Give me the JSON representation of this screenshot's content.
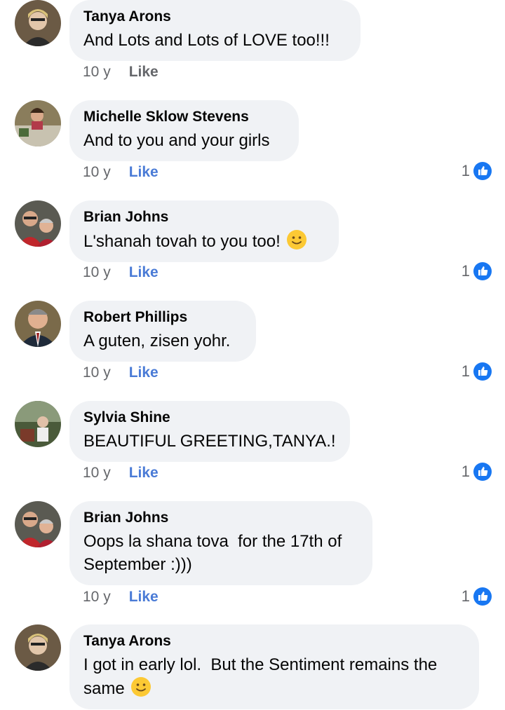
{
  "comments": [
    {
      "author": "Tanya Arons",
      "line1": "And Lots and Lots of LOVE too!!!",
      "line2": "",
      "age": "10 y",
      "like_label": "Like",
      "likes": ""
    },
    {
      "author": "Michelle Sklow Stevens",
      "line1": "And to you and your girls",
      "line2": "",
      "age": "10 y",
      "like_label": "Like",
      "likes": "1"
    },
    {
      "author": "Brian Johns",
      "line1": "L'shanah tovah to you too!",
      "line2": "",
      "age": "10 y",
      "like_label": "Like",
      "likes": "1"
    },
    {
      "author": "Robert Phillips",
      "line1": "A guten, zisen yohr.",
      "line2": "",
      "age": "10 y",
      "like_label": "Like",
      "likes": "1"
    },
    {
      "author": "Sylvia Shine",
      "line1": "BEAUTIFUL GREETING,TANYA.!",
      "line2": "",
      "age": "10 y",
      "like_label": "Like",
      "likes": "1"
    },
    {
      "author": "Brian Johns",
      "line1": "Oops la shana tova  for the 17th of",
      "line2": "September :)))",
      "age": "10 y",
      "like_label": "Like",
      "likes": "1"
    },
    {
      "author": "Tanya Arons",
      "line1": "I got in early lol.  But the Sentiment remains the",
      "line2": "same",
      "age": "",
      "like_label": "",
      "likes": ""
    }
  ],
  "icons": {
    "reaction": "like-thumb-icon",
    "emoji": "smiley-emoji-icon"
  },
  "colors": {
    "bubble": "#f0f2f5",
    "like_active": "#4a7bd6",
    "meta_gray": "#65676b",
    "reaction_blue": "#1877f2"
  }
}
